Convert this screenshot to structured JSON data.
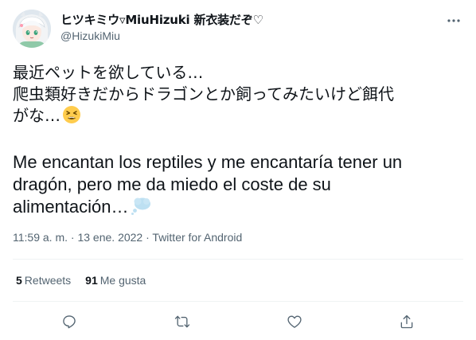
{
  "author": {
    "display_name": "ヒツキミウ▿MiuHizuki 新衣装だぞ♡",
    "handle": "@HizukiMiu",
    "avatar_icon": "avatar-anime-girl"
  },
  "tweet": {
    "lines_ja": [
      "最近ペットを欲している…",
      "爬虫類好きだからドラゴンとか飼ってみたいけど餌代",
      "がな…"
    ],
    "lines_es": [
      "Me encantan los reptiles y me encantaría tener un",
      "dragón, pero me da miedo el coste de su",
      "alimentación…"
    ],
    "emoji_ja": "tired-face-emoji",
    "emoji_es": "thought-balloon-emoji"
  },
  "meta": {
    "time": "11:59 a. m.",
    "sep1": " · ",
    "date": "13 ene. 2022",
    "sep2": " · ",
    "source": "Twitter for Android"
  },
  "stats": {
    "retweets_count": "5",
    "retweets_label": "Retweets",
    "likes_count": "91",
    "likes_label": "Me gusta"
  },
  "actions": [
    "reply-icon",
    "retweet-icon",
    "like-icon",
    "share-icon"
  ],
  "colors": {
    "text": "#0f1419",
    "secondary": "#536471",
    "divider": "#eff3f4"
  }
}
